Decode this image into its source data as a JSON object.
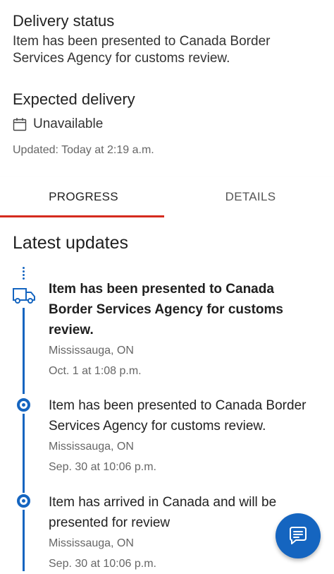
{
  "delivery": {
    "title": "Delivery status",
    "status_line1": "Item has been presented to Canada Border",
    "status_line2": "Services Agency for customs review."
  },
  "expected": {
    "title": "Expected delivery",
    "value": "Unavailable",
    "icon": "calendar-icon"
  },
  "updated": "Updated: Today at 2:19 a.m.",
  "tabs": [
    {
      "label": "PROGRESS",
      "active": true
    },
    {
      "label": "DETAILS",
      "active": false
    }
  ],
  "latest": {
    "title": "Latest updates",
    "events": [
      {
        "line1": "Item has been presented to Canada",
        "line2": "Border Services Agency for customs",
        "line3": "review.",
        "location": "Mississauga, ON",
        "time": "Oct. 1 at 1:08 p.m.",
        "icon": "truck-icon"
      },
      {
        "line1": "Item has been presented to Canada Border",
        "line2": "Services Agency for customs review.",
        "location": "Mississauga, ON",
        "time": "Sep. 30 at 10:06 p.m."
      },
      {
        "line1": "Item has arrived in Canada and will be",
        "line2": "presented for review",
        "location": "Mississauga, ON",
        "time": "Sep. 30 at 10:06 p.m."
      }
    ]
  },
  "colors": {
    "accent": "#1565c0",
    "tab_indicator": "#d52b1e"
  },
  "fab": {
    "icon": "chat-icon"
  }
}
